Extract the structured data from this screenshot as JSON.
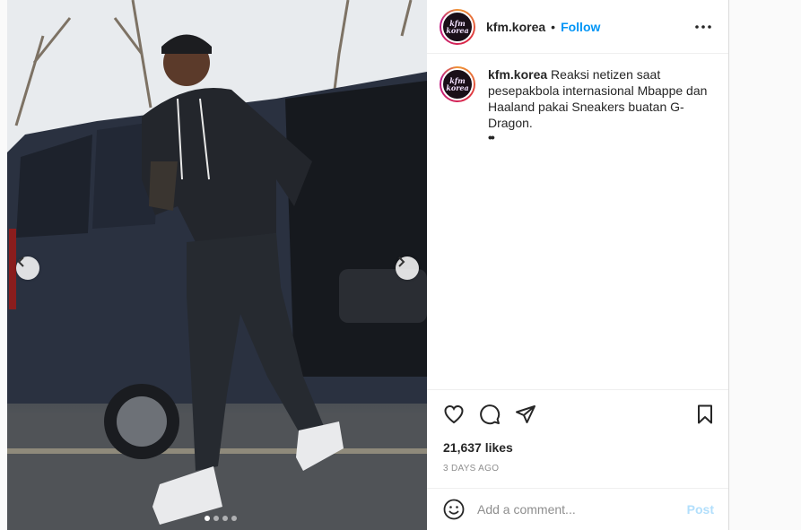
{
  "post": {
    "username": "kfm.korea",
    "separator": "•",
    "follow_label": "Follow",
    "avatar_text_line1": "kfm",
    "avatar_text_line2": "korea",
    "caption_username": "kfm.korea",
    "caption_text": "Reaksi netizen saat pesepakbola internasional Mbappe dan Haaland pakai Sneakers buatan G-Dragon.",
    "caption_extra": "••",
    "likes": "21,637 likes",
    "timestamp": "3 DAYS AGO"
  },
  "comment": {
    "placeholder": "Add a comment...",
    "post_label": "Post"
  },
  "carousel": {
    "total_slides": 4,
    "active_index": 0
  },
  "icons": {
    "like": "heart-icon",
    "comment": "comment-icon",
    "share": "paper-plane-icon",
    "save": "bookmark-icon",
    "emoji": "smiley-icon",
    "more": "ellipsis-icon",
    "prev": "chevron-left-icon",
    "next": "chevron-right-icon"
  },
  "colors": {
    "link": "#0095f6",
    "post_disabled": "#b2dffc",
    "muted": "#8e8e8e",
    "text": "#262626"
  }
}
